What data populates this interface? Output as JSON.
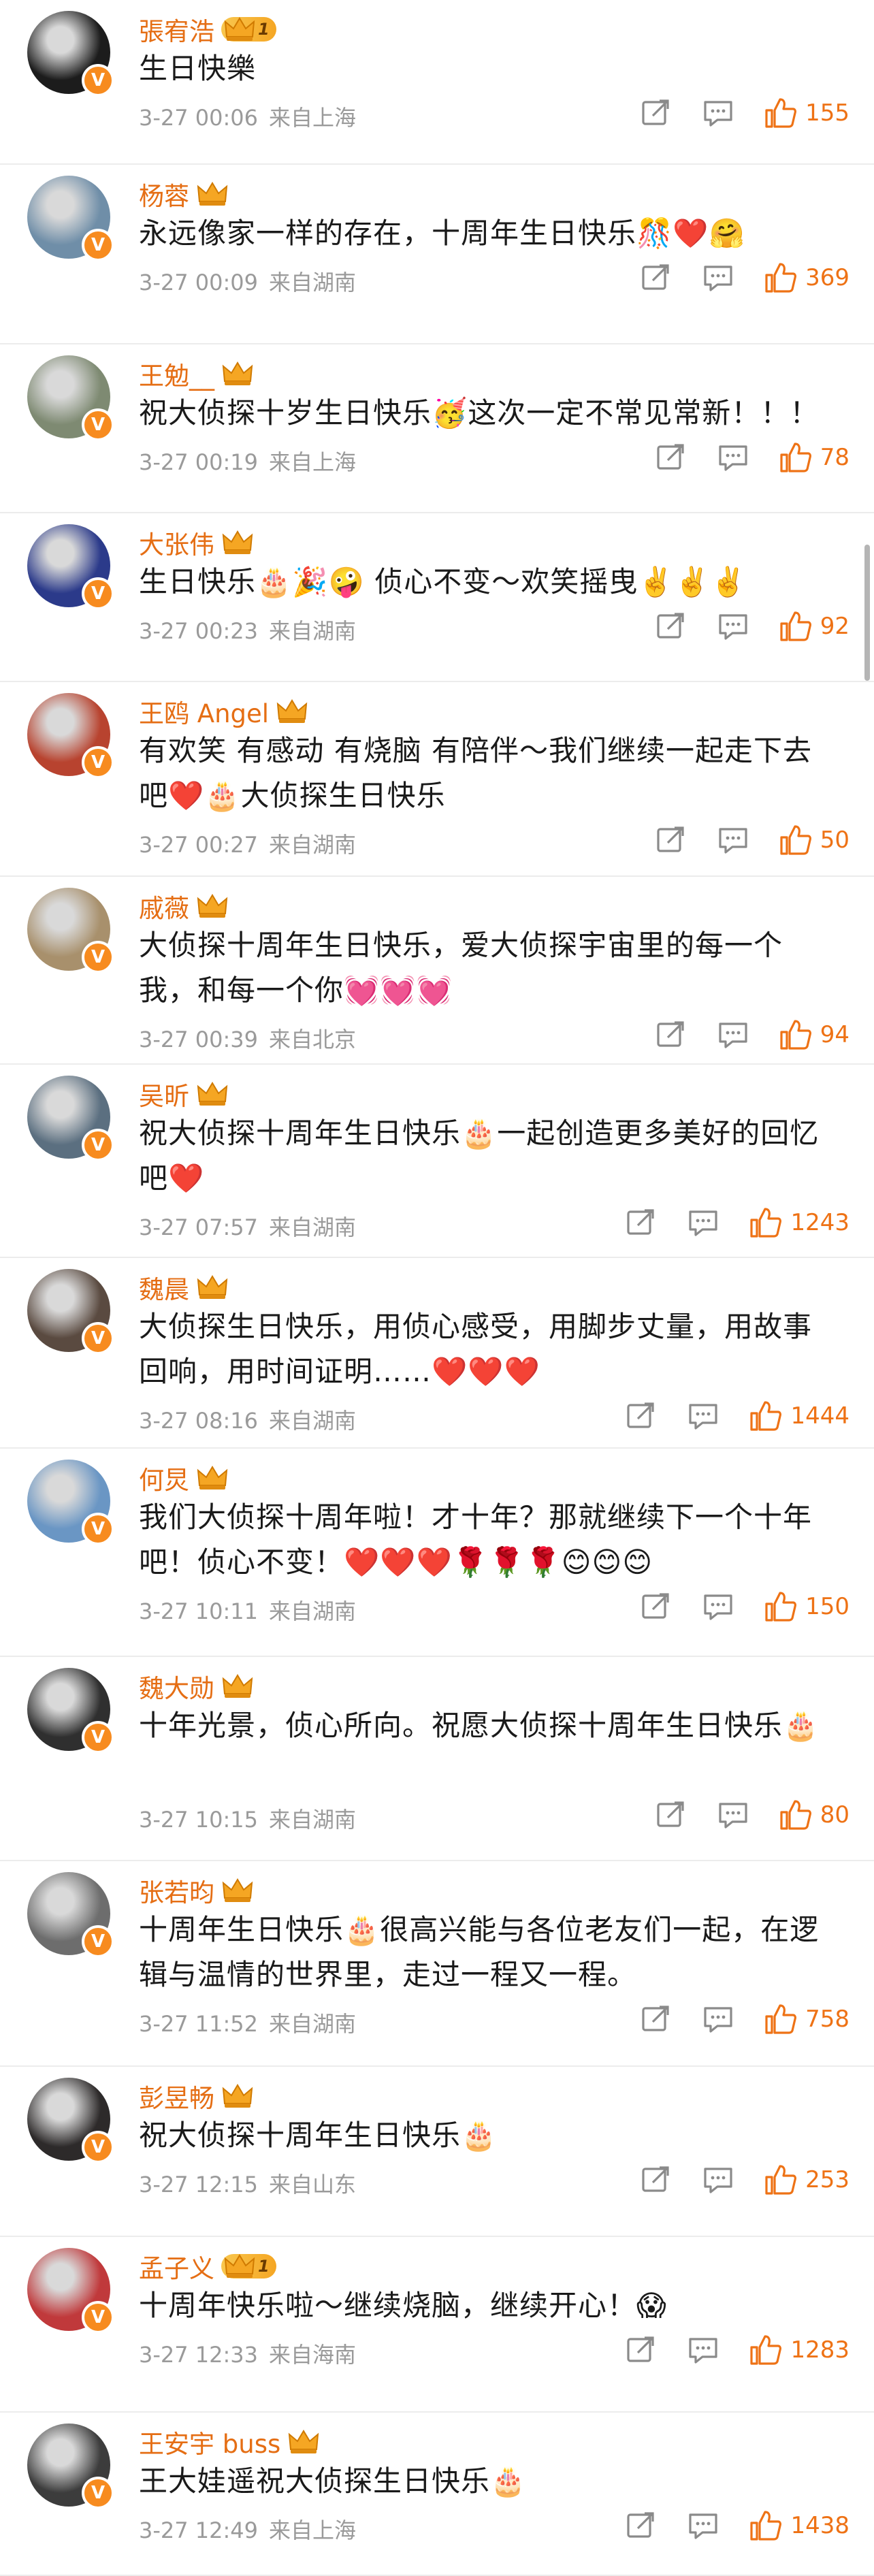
{
  "comments": [
    {
      "name": "張宥浩",
      "level": "1",
      "text": "生日快樂",
      "date": "3-27 00:06",
      "location": "来自上海",
      "likes": "155",
      "avatar_color": "#1c1c1c"
    },
    {
      "name": "杨蓉",
      "level": "",
      "text": "永远像家一样的存在，十周年生日快乐🎊❤️🤗",
      "date": "3-27 00:09",
      "location": "来自湖南",
      "likes": "369",
      "avatar_color": "#6f8ea8"
    },
    {
      "name": "王勉__",
      "level": "",
      "text": "祝大侦探十岁生日快乐🥳这次一定不常见常新！！！",
      "date": "3-27 00:19",
      "location": "来自上海",
      "likes": "78",
      "avatar_color": "#7e8a72"
    },
    {
      "name": "大张伟",
      "level": "",
      "text": "生日快乐🎂🎉🤪 侦心不变～欢笑摇曳✌️✌️✌️",
      "date": "3-27 00:23",
      "location": "来自湖南",
      "likes": "92",
      "avatar_color": "#2b3a8a"
    },
    {
      "name": "王鸥 Angel",
      "level": "",
      "text": "有欢笑 有感动 有烧脑 有陪伴～我们继续一起走下去吧❤️🎂大侦探生日快乐",
      "date": "3-27 00:27",
      "location": "来自湖南",
      "likes": "50",
      "avatar_color": "#b8432f"
    },
    {
      "name": "戚薇",
      "level": "",
      "text": "大侦探十周年生日快乐，爱大侦探宇宙里的每一个我，和每一个你💓💓💓",
      "date": "3-27 00:39",
      "location": "来自北京",
      "likes": "94",
      "avatar_color": "#a8906c"
    },
    {
      "name": "吴昕",
      "level": "",
      "text": "祝大侦探十周年生日快乐🎂一起创造更多美好的回忆吧❤️",
      "date": "3-27 07:57",
      "location": "来自湖南",
      "likes": "1243",
      "avatar_color": "#5b6f80"
    },
    {
      "name": "魏晨",
      "level": "",
      "text": "大侦探生日快乐，用侦心感受，用脚步丈量，用故事回响，用时间证明……❤️❤️❤️",
      "date": "3-27 08:16",
      "location": "来自湖南",
      "likes": "1444",
      "avatar_color": "#5a4a40"
    },
    {
      "name": "何炅",
      "level": "",
      "text": "我们大侦探十周年啦！才十年？那就继续下一个十年吧！侦心不变！❤️❤️❤️🌹🌹🌹😊😊😊",
      "date": "3-27 10:11",
      "location": "来自湖南",
      "likes": "150",
      "avatar_color": "#6a96c4"
    },
    {
      "name": "魏大勋",
      "level": "",
      "text": "十年光景，侦心所向。祝愿大侦探十周年生日快乐🎂",
      "date": "3-27 10:15",
      "location": "来自湖南",
      "likes": "80",
      "avatar_color": "#2f2f2f"
    },
    {
      "name": "张若昀",
      "level": "",
      "text": "十周年生日快乐🎂很高兴能与各位老友们一起，在逻辑与温情的世界里，走过一程又一程。",
      "date": "3-27 11:52",
      "location": "来自湖南",
      "likes": "758",
      "avatar_color": "#6d6d6d"
    },
    {
      "name": "彭昱畅",
      "level": "",
      "text": "祝大侦探十周年生日快乐🎂",
      "date": "3-27 12:15",
      "location": "来自山东",
      "likes": "253",
      "avatar_color": "#2d2a2a"
    },
    {
      "name": "孟子义",
      "level": "1",
      "text": "十周年快乐啦～继续烧脑，继续开心！😱",
      "date": "3-27 12:33",
      "location": "来自海南",
      "likes": "1283",
      "avatar_color": "#c0393b"
    },
    {
      "name": "王安宇 buss",
      "level": "",
      "text": "王大娃遥祝大侦探生日快乐🎂",
      "date": "3-27 12:49",
      "location": "来自上海",
      "likes": "1438",
      "avatar_color": "#3c3c3c"
    }
  ],
  "colors": {
    "name": "#e56e14",
    "likes": "#ee7215",
    "meta": "#9a9a9a",
    "text": "#1a1a1a"
  },
  "icons": {
    "share": "share-icon",
    "comment": "comment-icon",
    "like": "thumbs-up-icon",
    "crown": "crown-icon",
    "verified": "verified-v-icon"
  }
}
